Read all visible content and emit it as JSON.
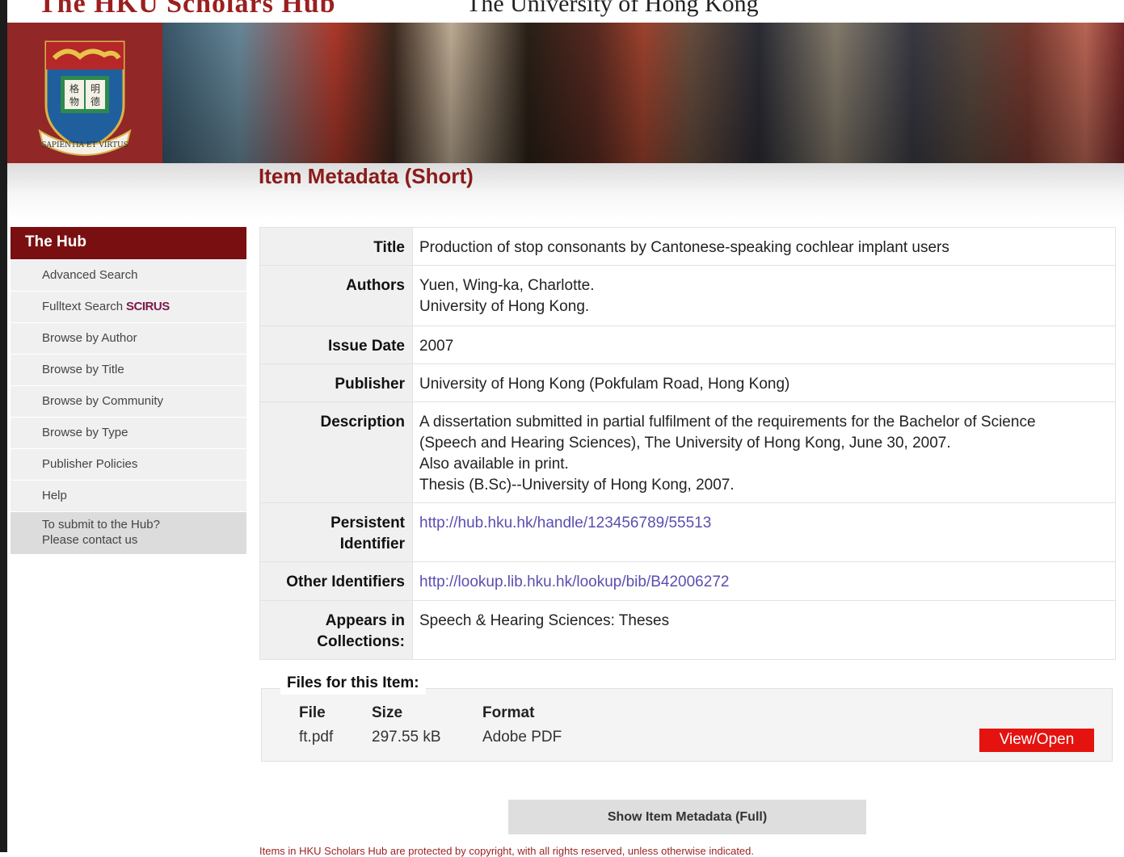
{
  "header": {
    "site_title": "The HKU Scholars Hub",
    "university": "The University of Hong Kong",
    "crest_motto": "SAPIENTIA ET VIRTUS",
    "crest_chars": [
      "格",
      "明",
      "物",
      "德"
    ],
    "brand_color": "#7a0f12"
  },
  "page_title": "Item Metadata (Short)",
  "sidebar": {
    "heading": "The Hub",
    "items": [
      {
        "label": "Advanced Search"
      },
      {
        "label": "Fulltext Search",
        "badge": "SCIRUS"
      },
      {
        "label": "Browse by Author"
      },
      {
        "label": "Browse by Title"
      },
      {
        "label": "Browse by Community"
      },
      {
        "label": "Browse by Type"
      },
      {
        "label": "Publisher Policies"
      },
      {
        "label": "Help"
      }
    ],
    "contact_line1": "To submit to the Hub?",
    "contact_line2": "Please contact us"
  },
  "metadata": {
    "title_label": "Title",
    "title_value": "Production of stop consonants by Cantonese-speaking cochlear implant users",
    "authors_label": "Authors",
    "authors": [
      "Yuen, Wing-ka, Charlotte.",
      "University of Hong Kong."
    ],
    "issue_date_label": "Issue Date",
    "issue_date": "2007",
    "publisher_label": "Publisher",
    "publisher": "University of Hong Kong (Pokfulam Road, Hong Kong)",
    "description_label": "Description",
    "description": [
      "A dissertation submitted in partial fulfilment of the requirements for the Bachelor of Science",
      "(Speech and Hearing Sciences), The University of Hong Kong, June 30, 2007.",
      "Also available in print.",
      "Thesis (B.Sc)--University of Hong Kong, 2007."
    ],
    "persistent_label_1": "Persistent",
    "persistent_label_2": "Identifier",
    "persistent_url": "http://hub.hku.hk/handle/123456789/55513",
    "other_ids_label": "Other Identifiers",
    "other_ids_url": "http://lookup.lib.hku.hk/lookup/bib/B42006272",
    "collections_label_1": "Appears in",
    "collections_label_2": "Collections:",
    "collections": "Speech & Hearing Sciences: Theses"
  },
  "files": {
    "legend": "Files for this Item:",
    "col_file": "File",
    "col_size": "Size",
    "col_format": "Format",
    "file_name": "ft.pdf",
    "file_size": "297.55 kB",
    "file_format": "Adobe PDF",
    "view_label": "View/Open"
  },
  "show_full_label": "Show Item Metadata (Full)",
  "bottom_note": "Items in HKU Scholars Hub are protected by copyright, with all rights reserved, unless otherwise indicated."
}
